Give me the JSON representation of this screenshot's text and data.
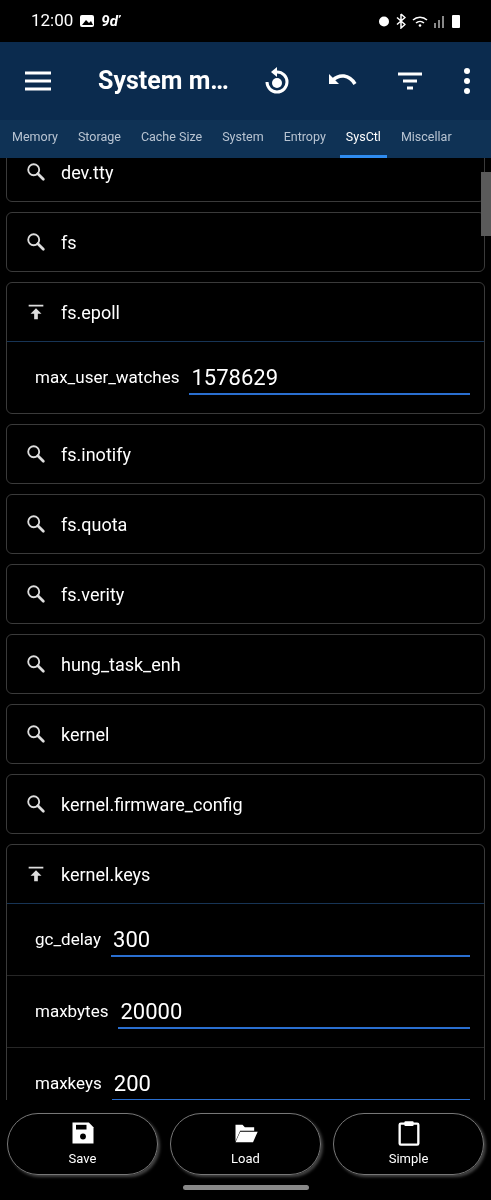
{
  "status_bar": {
    "time": "12:00",
    "carrier_text": "9ď"
  },
  "app_bar": {
    "title": "System m…"
  },
  "tabs": [
    {
      "label": "Memory",
      "selected": false
    },
    {
      "label": "Storage",
      "selected": false
    },
    {
      "label": "Cache Size",
      "selected": false
    },
    {
      "label": "System",
      "selected": false
    },
    {
      "label": "Entropy",
      "selected": false
    },
    {
      "label": "SysCtl",
      "selected": true
    },
    {
      "label": "Miscellar",
      "selected": false
    }
  ],
  "groups": [
    {
      "name": "dev.tty",
      "expanded": false
    },
    {
      "name": "fs",
      "expanded": false
    },
    {
      "name": "fs.epoll",
      "expanded": true,
      "params": [
        {
          "name": "max_user_watches",
          "value": "1578629"
        }
      ]
    },
    {
      "name": "fs.inotify",
      "expanded": false
    },
    {
      "name": "fs.quota",
      "expanded": false
    },
    {
      "name": "fs.verity",
      "expanded": false
    },
    {
      "name": "hung_task_enh",
      "expanded": false
    },
    {
      "name": "kernel",
      "expanded": false
    },
    {
      "name": "kernel.firmware_config",
      "expanded": false
    },
    {
      "name": "kernel.keys",
      "expanded": true,
      "params": [
        {
          "name": "gc_delay",
          "value": "300"
        },
        {
          "name": "maxbytes",
          "value": "20000"
        },
        {
          "name": "maxkeys",
          "value": "200"
        }
      ]
    }
  ],
  "bottom_buttons": [
    {
      "kind": "save",
      "label": "Save"
    },
    {
      "kind": "load",
      "label": "Load"
    },
    {
      "kind": "simple",
      "label": "Simple"
    }
  ]
}
